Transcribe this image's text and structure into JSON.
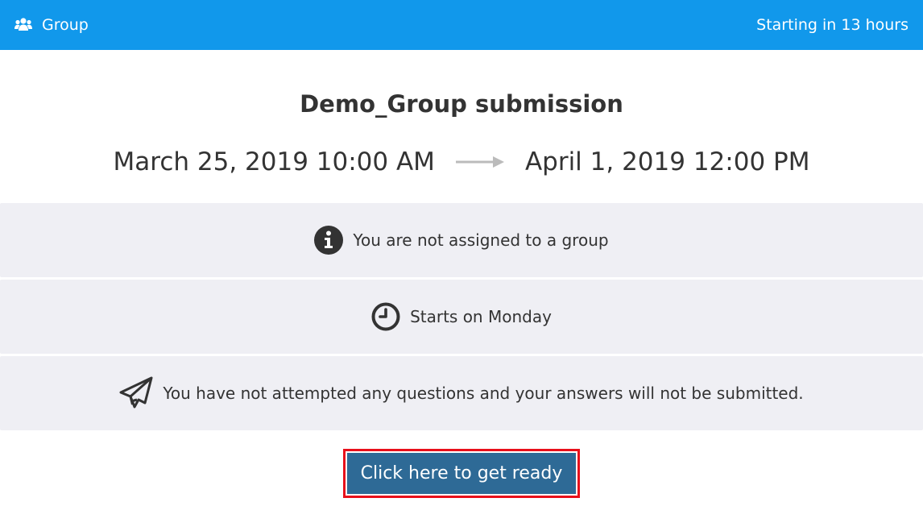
{
  "header": {
    "title": "Group",
    "title_icon": "users-icon",
    "status": "Starting in 13 hours",
    "background": "#1198eb"
  },
  "main": {
    "title": "Demo_Group submission",
    "start_date": "March 25, 2019 10:00 AM",
    "end_date": "April 1, 2019 12:00 PM"
  },
  "panels": [
    {
      "icon": "info-circle-icon",
      "text": "You are not assigned to a group"
    },
    {
      "icon": "clock-icon",
      "text": "Starts on Monday"
    },
    {
      "icon": "paper-plane-icon",
      "text": "You have not attempted any questions and your answers will not be submitted."
    }
  ],
  "action": {
    "label": "Click here to get ready",
    "background": "#2e6a96",
    "highlight": "#e8101b"
  }
}
